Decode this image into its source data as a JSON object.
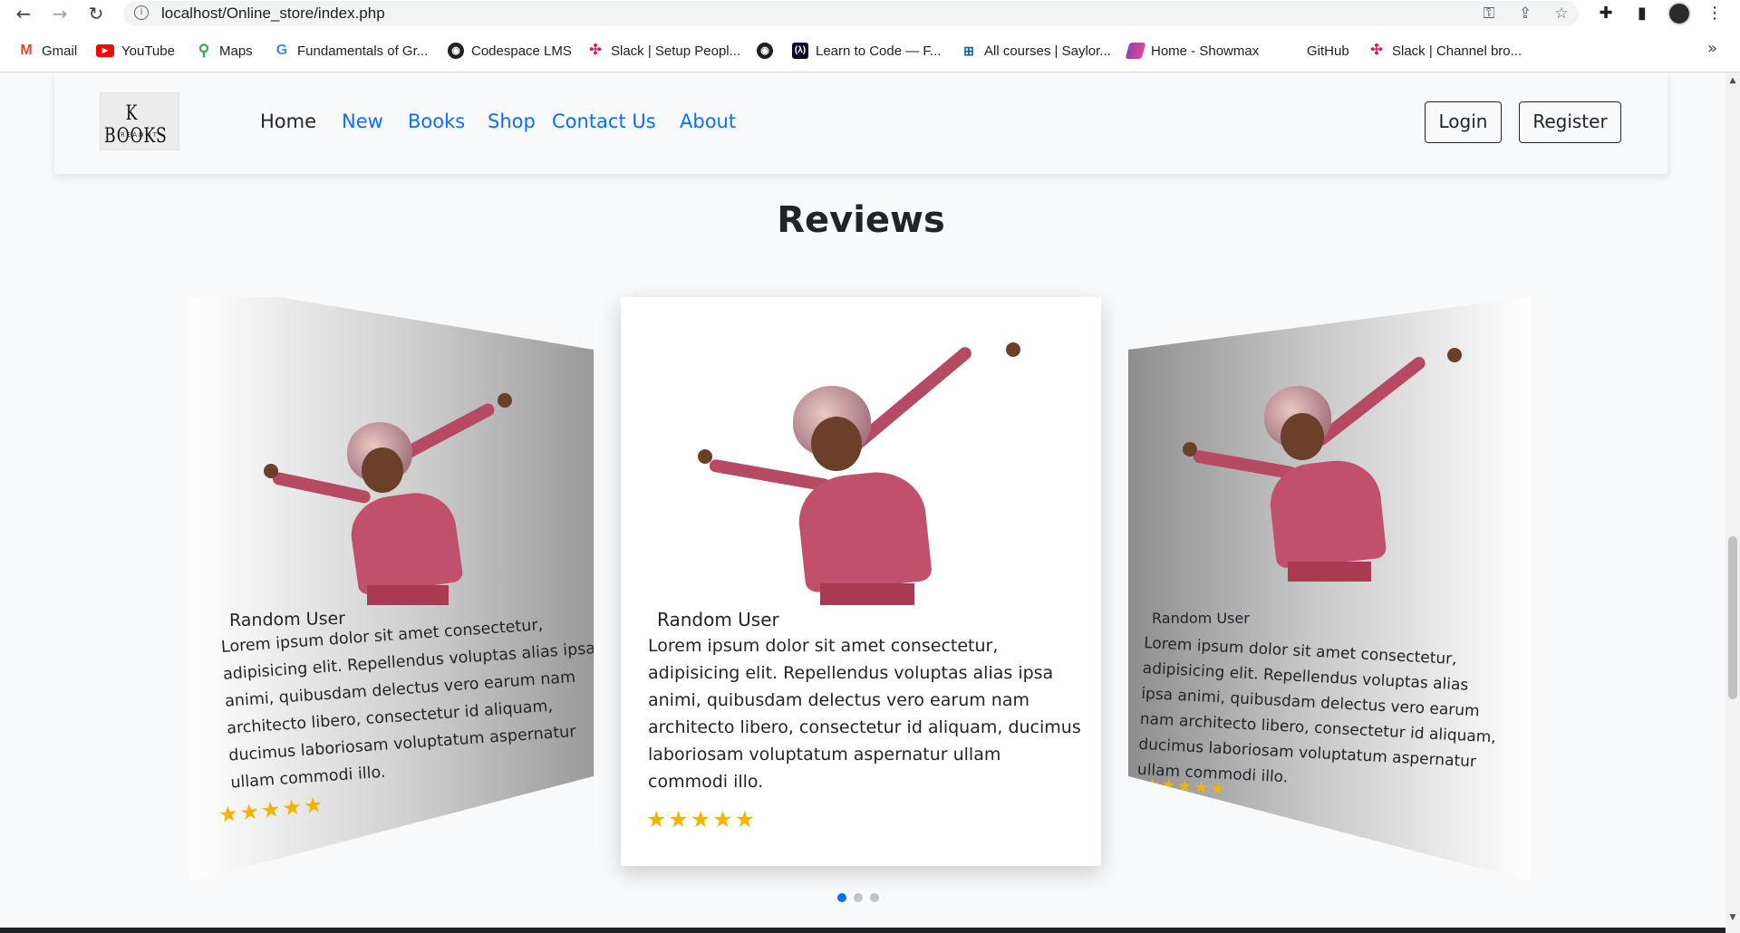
{
  "browser": {
    "url": "localhost/Online_store/index.php",
    "bookmarks": [
      {
        "label": "Gmail",
        "icon": "gmail-icon",
        "color": "#ea4335"
      },
      {
        "label": "YouTube",
        "icon": "youtube-icon",
        "color": "#ff0000"
      },
      {
        "label": "Maps",
        "icon": "maps-icon",
        "color": "#34a853"
      },
      {
        "label": "Fundamentals of Gr...",
        "icon": "google-icon",
        "color": "#4285f4"
      },
      {
        "label": "Codespace LMS",
        "icon": "globe-icon",
        "color": "#202124"
      },
      {
        "label": "Slack | Setup Peopl...",
        "icon": "slack-icon",
        "color": "#e01e5a"
      },
      {
        "label": "",
        "icon": "globe-icon",
        "color": "#202124"
      },
      {
        "label": "Learn to Code — F...",
        "icon": "freecodecamp-icon",
        "color": "#0a0a23"
      },
      {
        "label": "All courses | Saylor...",
        "icon": "saylor-icon",
        "color": "#1b5e9b"
      },
      {
        "label": "Home - Showmax",
        "icon": "showmax-icon",
        "color": "#8e44ad"
      },
      {
        "label": "GitHub",
        "icon": "",
        "color": ""
      },
      {
        "label": "Slack | Channel bro...",
        "icon": "slack-icon",
        "color": "#e01e5a"
      }
    ]
  },
  "navbar": {
    "logo_text": "K BOOKS",
    "logo_sub": "READ IT",
    "links": [
      "Home",
      "New",
      "Books",
      "Shop",
      "Contact Us",
      "About"
    ],
    "login": "Login",
    "register": "Register"
  },
  "reviews": {
    "title": "Reviews",
    "cards": [
      {
        "name": "Random User",
        "text": "Lorem ipsum dolor sit amet consectetur, adipisicing elit. Repellendus voluptas alias ipsa animi, quibusdam delectus vero earum nam architecto libero, consectetur id aliquam, ducimus laboriosam voluptatum aspernatur ullam commodi illo.",
        "stars": "★★★★★",
        "rating": 5
      },
      {
        "name": "Random User",
        "text": "Lorem ipsum dolor sit amet consectetur, adipisicing elit. Repellendus voluptas alias ipsa animi, quibusdam delectus vero earum nam architecto libero, consectetur id aliquam, ducimus laboriosam voluptatum aspernatur ullam commodi illo.",
        "stars": "★★★★★",
        "rating": 5
      },
      {
        "name": "Random User",
        "text": "Lorem ipsum dolor sit amet consectetur, adipisicing elit. Repellendus voluptas alias ipsa animi, quibusdam delectus vero earum nam architecto libero, consectetur id aliquam, ducimus laboriosam voluptatum aspernatur ullam commodi illo.",
        "stars": "★★★★★",
        "rating": 5
      }
    ],
    "active_slide": 1,
    "slide_count": 3
  },
  "colors": {
    "link": "#0d6efd",
    "star": "#f5b301",
    "dot_active": "#0d6efd"
  }
}
